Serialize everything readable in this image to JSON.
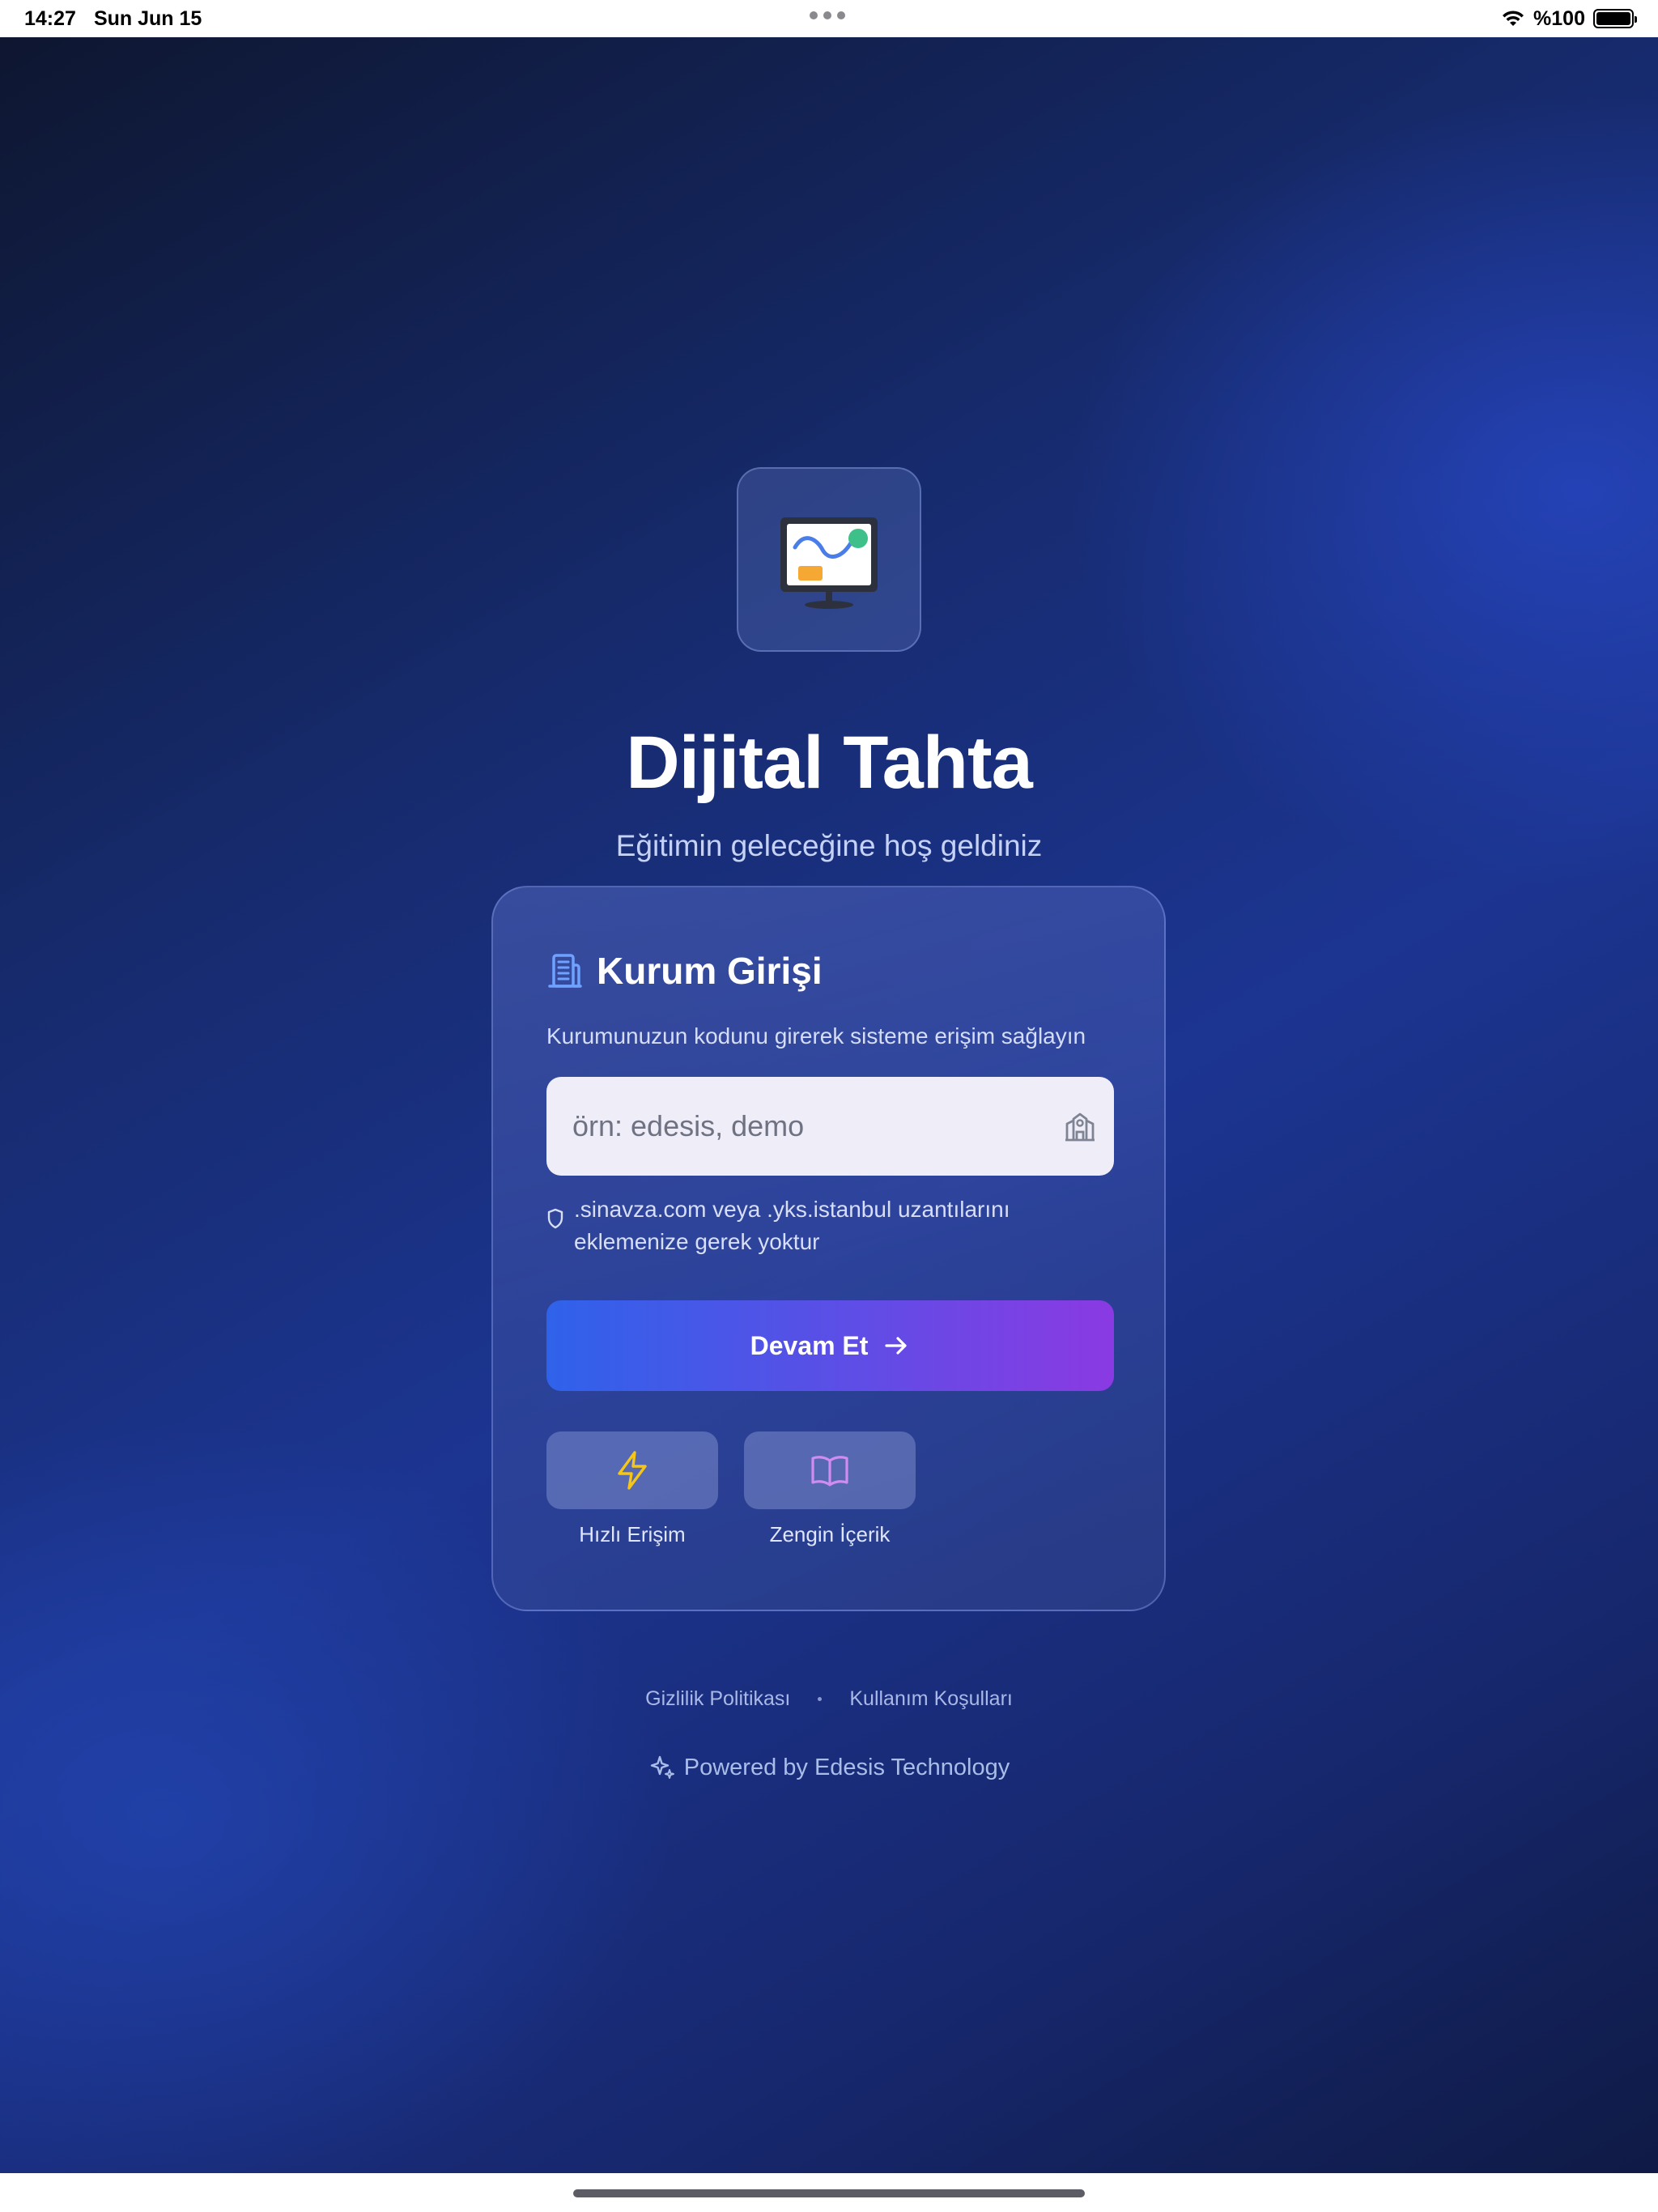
{
  "status_bar": {
    "time": "14:27",
    "date": "Sun Jun 15",
    "battery": "%100"
  },
  "app": {
    "title": "Dijital Tahta",
    "subtitle": "Eğitimin geleceğine hoş geldiniz",
    "icon": "digital-whiteboard-icon"
  },
  "login_card": {
    "title": "Kurum Girişi",
    "title_icon": "building-icon",
    "description": "Kurumunuzun kodunu girerek sisteme erişim sağlayın",
    "input": {
      "value": "",
      "placeholder": "örn: edesis, demo",
      "icon": "school-icon"
    },
    "hint": ".sinavza.com veya .yks.istanbul uzantılarını eklemenize gerek yoktur",
    "hint_icon": "shield-icon",
    "continue_label": "Devam Et",
    "features": [
      {
        "label": "Hızlı Erişim",
        "icon": "lightning-icon",
        "color": "#f5c518"
      },
      {
        "label": "Zengin İçerik",
        "icon": "book-open-icon",
        "color": "#d08cf0"
      }
    ]
  },
  "footer": {
    "privacy": "Gizlilik Politikası",
    "terms": "Kullanım Koşulları",
    "powered_by": "Powered by Edesis Technology"
  },
  "colors": {
    "accent_start": "#2f62ea",
    "accent_end": "#8a3ae2",
    "background_dark": "#0e1630",
    "background_blue": "#1c3591"
  }
}
